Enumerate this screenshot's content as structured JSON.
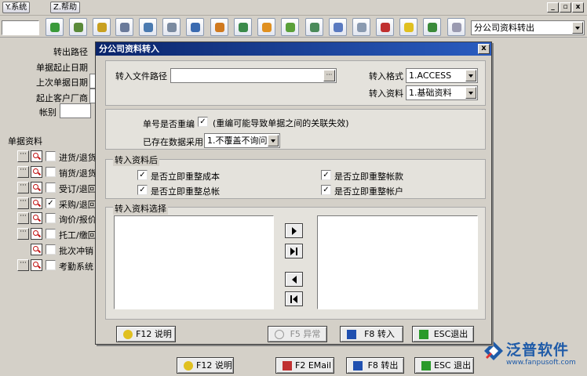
{
  "menubar": {
    "items": [
      "Y.系统",
      "Z.帮助"
    ],
    "window_controls": [
      "_",
      "▫",
      "x"
    ]
  },
  "toolbar": {
    "combo_value": "分公司资料转出"
  },
  "background_form": {
    "labels": [
      "转出路径",
      "单据起止日期",
      "上次单据日期",
      "起止客户厂商",
      "帐别"
    ],
    "group_title": "单据资料",
    "documents": [
      {
        "label": "进货/退货",
        "checked": false,
        "dots": true
      },
      {
        "label": "销货/退货",
        "checked": false,
        "dots": true
      },
      {
        "label": "受订/退回",
        "checked": false,
        "dots": true
      },
      {
        "label": "采购/退回",
        "checked": true,
        "dots": true
      },
      {
        "label": "询价/报价",
        "checked": false,
        "dots": true
      },
      {
        "label": "托工/缴回",
        "checked": false,
        "dots": true
      },
      {
        "label": "批次冲销",
        "checked": false,
        "dots": false
      },
      {
        "label": "考勤系统",
        "checked": false,
        "dots": true
      }
    ]
  },
  "bottom_bar": {
    "help": "F12 说明",
    "email": "F2 EMail",
    "export": "F8 转出",
    "exit": "ESC 退出"
  },
  "logo": {
    "name": "泛普软件",
    "url": "www.fanpusoft.com"
  },
  "dialog": {
    "title": "分公司资料转入",
    "close": "x",
    "file_path_label": "转入文件路径",
    "file_path_value": "",
    "browse": "···",
    "format_label": "转入格式",
    "format_value": "1.ACCESS",
    "data_label": "转入资料",
    "data_value": "1.基础资料",
    "renumber_label": "单号是否重编",
    "renumber_checked": true,
    "renumber_note": "(重编可能导致单据之间的关联失效)",
    "existing_label": "已存在数据采用",
    "existing_value": "1.不覆盖不询问",
    "after_title": "转入资料后",
    "after_options": [
      {
        "label": "是否立即重整成本",
        "checked": true
      },
      {
        "label": "是否立即重整帐款",
        "checked": true
      },
      {
        "label": "是否立即重整总帐",
        "checked": true
      },
      {
        "label": "是否立即重整帐户",
        "checked": true
      }
    ],
    "select_title": "转入资料选择",
    "buttons": {
      "help": "F12 说明",
      "exception": "F5 异常",
      "import": "F8 转入",
      "exit": "ESC退出"
    }
  },
  "colors": {
    "title_bar": "#0a246a",
    "logo_blue": "#1f5ba8",
    "window_bg": "#d4d0c8"
  }
}
